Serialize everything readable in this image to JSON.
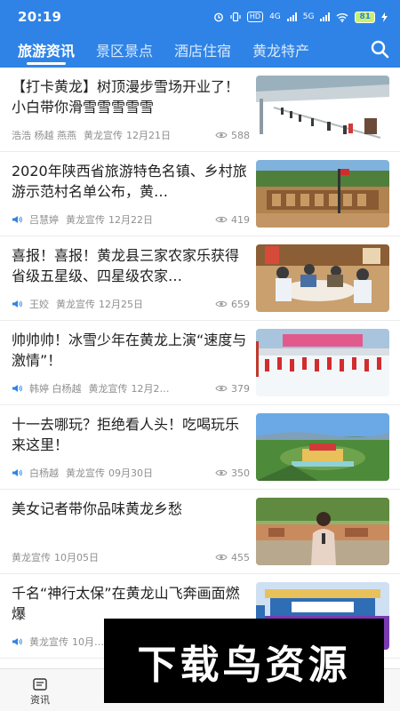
{
  "status_bar": {
    "time": "20:19",
    "hd": "HD",
    "net1": "4G",
    "net2": "5G",
    "battery": "81"
  },
  "tabs": [
    {
      "label": "旅游资讯",
      "active": true
    },
    {
      "label": "景区景点",
      "active": false
    },
    {
      "label": "酒店住宿",
      "active": false
    },
    {
      "label": "黄龙特产",
      "active": false
    }
  ],
  "articles": [
    {
      "title": "【打卡黄龙】树顶漫步雪场开业了！小白带你滑雪雪雪雪雪",
      "authors": "浩浩 杨越 燕燕",
      "source": "黄龙宣传",
      "date": "12月21日",
      "views": "588",
      "audio": false,
      "thumb": "ski-slope-photo"
    },
    {
      "title": "2020年陕西省旅游特色名镇、乡村旅游示范村名单公布，黄…",
      "authors": "吕慧婷",
      "source": "黄龙宣传",
      "date": "12月22日",
      "views": "419",
      "audio": true,
      "thumb": "village-gate-photo"
    },
    {
      "title": "喜报！喜报！黄龙县三家农家乐获得省级五星级、四星级农家…",
      "authors": "王姣",
      "source": "黄龙宣传",
      "date": "12月25日",
      "views": "659",
      "audio": true,
      "thumb": "farm-restaurant-photo"
    },
    {
      "title": "帅帅帅！冰雪少年在黄龙上演“速度与激情”！",
      "authors": "韩婷 白杨越",
      "source": "黄龙宣传",
      "date": "12月2…",
      "views": "379",
      "audio": true,
      "thumb": "ice-skating-photo"
    },
    {
      "title": "十一去哪玩？拒绝看人头！吃喝玩乐来这里！",
      "authors": "白杨越",
      "source": "黄龙宣传",
      "date": "09月30日",
      "views": "350",
      "audio": true,
      "thumb": "aerial-resort-photo"
    },
    {
      "title": "美女记者带你品味黄龙乡愁",
      "authors": "",
      "source": "黄龙宣传",
      "date": "10月05日",
      "views": "455",
      "audio": false,
      "thumb": "reporter-photo"
    },
    {
      "title": "千名“神行太保”在黄龙山飞奔画面燃爆",
      "authors": "",
      "source": "黄龙宣传",
      "date": "10月…",
      "views": "",
      "audio": true,
      "thumb": "marathon-photo"
    }
  ],
  "bottom_nav": {
    "news_label": "资讯"
  },
  "watermark": "下载鸟资源",
  "colors": {
    "brand_blue": "#2f83e6",
    "meta_gray": "#8f8f8f"
  }
}
